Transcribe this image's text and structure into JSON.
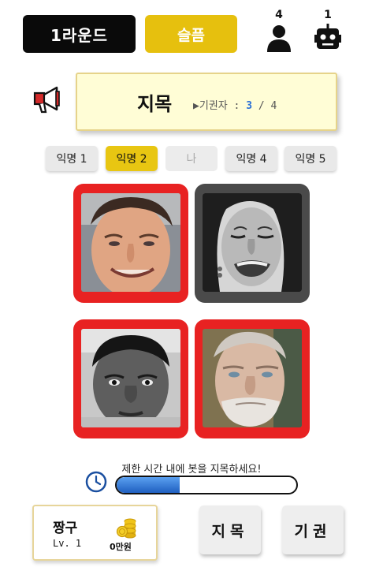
{
  "header": {
    "round_label": "1라운드",
    "mood_label": "슬픔",
    "human_count": "4",
    "bot_count": "1",
    "human_icon": "person-icon",
    "bot_icon": "robot-icon"
  },
  "topic": {
    "icon": "megaphone-icon",
    "title": "지목",
    "voters_label": "▶기권자 : ",
    "voters_current": "3",
    "voters_sep": " / ",
    "voters_total": "4"
  },
  "players": [
    {
      "label": "익명 1",
      "state": "normal"
    },
    {
      "label": "익명 2",
      "state": "active"
    },
    {
      "label": "나",
      "state": "self"
    },
    {
      "label": "익명 4",
      "state": "normal"
    },
    {
      "label": "익명 5",
      "state": "normal"
    }
  ],
  "cards": [
    {
      "name": "smiling-man-photo",
      "frame": "red"
    },
    {
      "name": "crying-woman-photo",
      "frame": "gray"
    },
    {
      "name": "boy-portrait-photo",
      "frame": "red"
    },
    {
      "name": "old-man-portrait-photo",
      "frame": "red"
    }
  ],
  "timer": {
    "text": "제한 시간 내에 봇을 지목하세요!",
    "progress": 0.35
  },
  "profile": {
    "name": "짱구",
    "level": "Lv. 1",
    "money": "0만원"
  },
  "actions": {
    "point_label": "지목",
    "abstain_label": "기권"
  },
  "colors": {
    "accent_yellow": "#e6c00e",
    "frame_red": "#e82222",
    "frame_gray": "#4a4a4a",
    "progress_blue": "#2a6fd6"
  }
}
